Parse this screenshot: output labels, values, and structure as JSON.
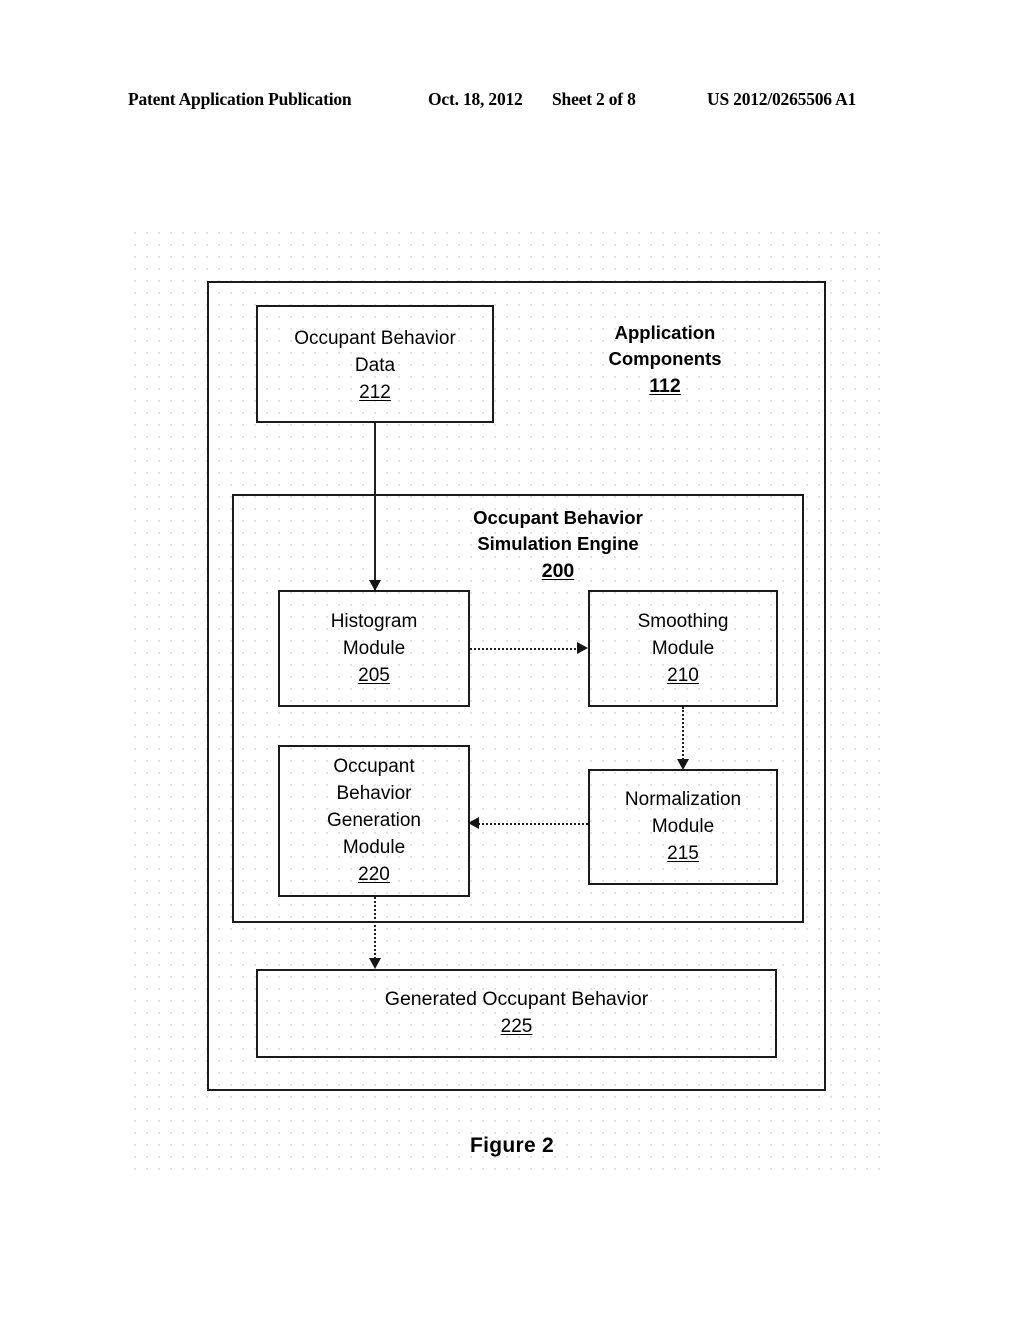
{
  "header": {
    "publication": "Patent Application Publication",
    "date": "Oct. 18, 2012",
    "sheet": "Sheet 2 of 8",
    "patent_number": "US 2012/0265506 A1"
  },
  "figure": {
    "caption": "Figure 2",
    "outer_container": {
      "title_line_1": "Application",
      "title_line_2": "Components",
      "ref": "112"
    },
    "data_box": {
      "line_1": "Occupant Behavior",
      "line_2": "Data",
      "ref": "212"
    },
    "engine": {
      "title_line_1": "Occupant Behavior",
      "title_line_2": "Simulation Engine",
      "ref": "200"
    },
    "modules": {
      "histogram": {
        "line_1": "Histogram",
        "line_2": "Module",
        "ref": "205"
      },
      "smoothing": {
        "line_1": "Smoothing",
        "line_2": "Module",
        "ref": "210"
      },
      "normalization": {
        "line_1": "Normalization",
        "line_2": "Module",
        "ref": "215"
      },
      "generation": {
        "line_1": "Occupant",
        "line_2": "Behavior",
        "line_3": "Generation",
        "line_4": "Module",
        "ref": "220"
      }
    },
    "output_box": {
      "line_1": "Generated Occupant Behavior",
      "ref": "225"
    }
  },
  "colors": {
    "ink": "#1a1a1a",
    "grid_dot": "#e2e2e2",
    "page": "#ffffff"
  }
}
